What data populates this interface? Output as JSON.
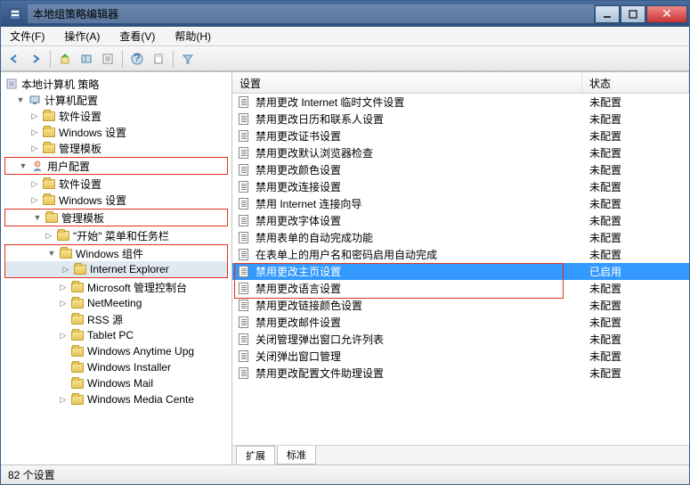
{
  "window": {
    "title": "本地组策略编辑器"
  },
  "menu": {
    "file": "文件(F)",
    "action": "操作(A)",
    "view": "查看(V)",
    "help": "帮助(H)"
  },
  "tree": {
    "root": "本地计算机 策略",
    "computer": "计算机配置",
    "comp_soft": "软件设置",
    "comp_win": "Windows 设置",
    "comp_admin": "管理模板",
    "user": "用户配置",
    "user_soft": "软件设置",
    "user_win": "Windows 设置",
    "user_admin": "管理模板",
    "start_menu": "\"开始\" 菜单和任务栏",
    "win_comp": "Windows 组件",
    "ie": "Internet Explorer",
    "mmc": "Microsoft 管理控制台",
    "netmeeting": "NetMeeting",
    "rss": "RSS 源",
    "tablet": "Tablet PC",
    "anytime": "Windows Anytime Upg",
    "installer": "Windows Installer",
    "mail": "Windows Mail",
    "mediactr": "Windows Media Cente"
  },
  "columns": {
    "setting": "设置",
    "status": "状态"
  },
  "status": {
    "unconfigured": "未配置",
    "enabled": "已启用"
  },
  "rows": [
    {
      "text": "禁用更改 Internet 临时文件设置",
      "status": "unconfigured"
    },
    {
      "text": "禁用更改日历和联系人设置",
      "status": "unconfigured"
    },
    {
      "text": "禁用更改证书设置",
      "status": "unconfigured"
    },
    {
      "text": "禁用更改默认浏览器检查",
      "status": "unconfigured"
    },
    {
      "text": "禁用更改颜色设置",
      "status": "unconfigured"
    },
    {
      "text": "禁用更改连接设置",
      "status": "unconfigured"
    },
    {
      "text": "禁用 Internet 连接向导",
      "status": "unconfigured"
    },
    {
      "text": "禁用更改字体设置",
      "status": "unconfigured"
    },
    {
      "text": "禁用表单的自动完成功能",
      "status": "unconfigured"
    },
    {
      "text": "在表单上的用户名和密码启用自动完成",
      "status": "unconfigured"
    },
    {
      "text": "禁用更改主页设置",
      "status": "enabled",
      "selected": true
    },
    {
      "text": "禁用更改语言设置",
      "status": "unconfigured"
    },
    {
      "text": "禁用更改链接颜色设置",
      "status": "unconfigured"
    },
    {
      "text": "禁用更改邮件设置",
      "status": "unconfigured"
    },
    {
      "text": "关闭管理弹出窗口允许列表",
      "status": "unconfigured"
    },
    {
      "text": "关闭弹出窗口管理",
      "status": "unconfigured"
    },
    {
      "text": "禁用更改配置文件助理设置",
      "status": "unconfigured"
    }
  ],
  "tabs": {
    "extended": "扩展",
    "standard": "标准"
  },
  "statusbar": {
    "text": "82 个设置"
  }
}
